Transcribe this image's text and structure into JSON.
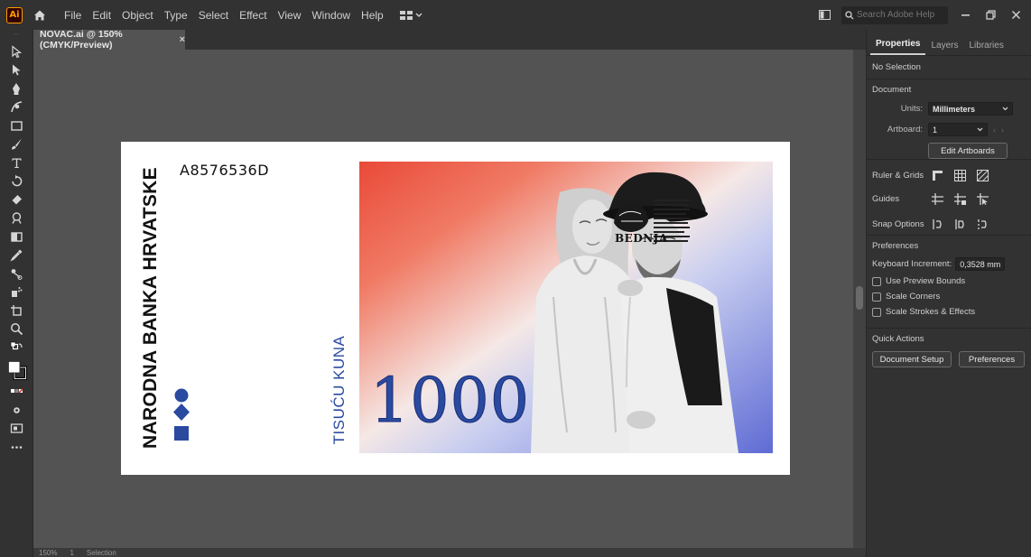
{
  "app": {
    "logo": "Ai",
    "menus": [
      "File",
      "Edit",
      "Object",
      "Type",
      "Select",
      "Effect",
      "View",
      "Window",
      "Help"
    ],
    "search_placeholder": "Search Adobe Help"
  },
  "document": {
    "tab_title": "NOVAC.ai @ 150% (CMYK/Preview)",
    "close": "×"
  },
  "artwork": {
    "bank_name": "NARODNA BANKA HRVATSKE",
    "serial": "A8576536D",
    "value_words": "TISUĆU KUNA",
    "value_number": "1000",
    "emblem_name": "BEDNJA",
    "colors": {
      "blue": "#2a4aa0",
      "red": "#e94a38",
      "violet": "#5f6bd4"
    }
  },
  "status": {
    "zoom": "150%",
    "artboard_no": "1",
    "mode": "Selection"
  },
  "properties": {
    "tabs": [
      "Properties",
      "Layers",
      "Libraries"
    ],
    "selection": "No Selection",
    "document_heading": "Document",
    "units_label": "Units:",
    "units_value": "Millimeters",
    "artboard_label": "Artboard:",
    "artboard_value": "1",
    "edit_artboards": "Edit Artboards",
    "ruler_grids": "Ruler & Grids",
    "guides": "Guides",
    "snap_options": "Snap Options",
    "preferences_heading": "Preferences",
    "keyboard_increment_label": "Keyboard Increment:",
    "keyboard_increment_value": "0,3528 mm",
    "use_preview_bounds": "Use Preview Bounds",
    "scale_corners": "Scale Corners",
    "scale_strokes": "Scale Strokes & Effects",
    "quick_actions": "Quick Actions",
    "document_setup": "Document Setup",
    "preferences_button": "Preferences"
  }
}
